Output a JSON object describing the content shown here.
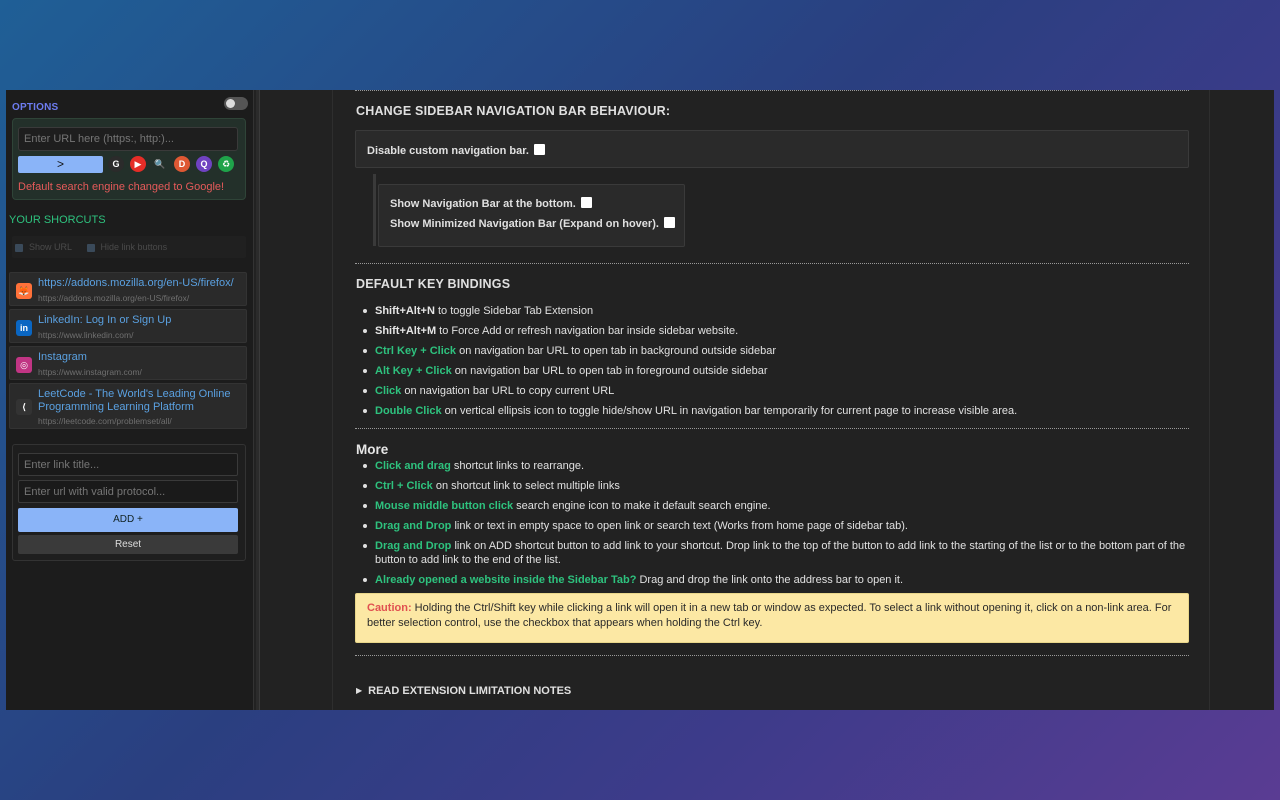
{
  "sidebar": {
    "options_title": "OPTIONS",
    "url_placeholder": "Enter URL here (https:, http:)...",
    "go_label": ">",
    "search_engines": [
      {
        "name": "google-icon",
        "glyph": "G",
        "color": "#ffffff",
        "bg": "#2b2b2b"
      },
      {
        "name": "youtube-icon",
        "glyph": "▶",
        "color": "#ffffff",
        "bg": "#e52d27"
      },
      {
        "name": "search-icon",
        "glyph": "🔍",
        "color": "#4aa3ff",
        "bg": "transparent"
      },
      {
        "name": "duckduckgo-icon",
        "glyph": "D",
        "color": "#ffffff",
        "bg": "#de5833"
      },
      {
        "name": "qwant-icon",
        "glyph": "Q",
        "color": "#ffffff",
        "bg": "#6f42c1"
      },
      {
        "name": "recycle-icon",
        "glyph": "♻",
        "color": "#ffffff",
        "bg": "#1fa34a"
      }
    ],
    "search_message": "Default search engine changed to Google!",
    "shortcuts_title": "YOUR SHORCUTS",
    "show_url_label": "Show URL",
    "hide_buttons_label": "Hide link buttons",
    "links": [
      {
        "title": "https://addons.mozilla.org/en-US/firefox/",
        "url": "https://addons.mozilla.org/en-US/firefox/",
        "icon": "firefox-icon",
        "glyph": "🦊",
        "bg": "#ff7139"
      },
      {
        "title": "LinkedIn: Log In or Sign Up",
        "url": "https://www.linkedin.com/",
        "icon": "linkedin-icon",
        "glyph": "in",
        "bg": "#0a66c2"
      },
      {
        "title": "Instagram",
        "url": "https://www.instagram.com/",
        "icon": "instagram-icon",
        "glyph": "◎",
        "bg": "#c13584"
      },
      {
        "title": "LeetCode - The World's Leading Online Programming Learning Platform",
        "url": "https://leetcode.com/problemset/all/",
        "icon": "leetcode-icon",
        "glyph": "⟨",
        "bg": "#333333"
      }
    ],
    "link_title_placeholder": "Enter link title...",
    "link_url_placeholder": "Enter url with valid protocol...",
    "add_label": "ADD +",
    "reset_label": "Reset"
  },
  "main": {
    "nav_section_title": "CHANGE SIDEBAR NAVIGATION BAR BEHAVIOUR:",
    "disable_nav_label": "Disable custom navigation bar.",
    "show_bottom_label": "Show Navigation Bar at the bottom.",
    "show_minimized_label": "Show Minimized Navigation Bar (Expand on hover).",
    "keys_title": "DEFAULT KEY BINDINGS",
    "key_bindings": [
      {
        "key": "Shift+Alt+N",
        "text": " to toggle Sidebar Tab Extension",
        "style": "k"
      },
      {
        "key": "Shift+Alt+M",
        "text": " to Force Add or refresh navigation bar inside sidebar website.",
        "style": "k"
      },
      {
        "key": "Ctrl Key + Click",
        "text": " on navigation bar URL to open tab in background outside sidebar",
        "style": "g"
      },
      {
        "key": "Alt Key + Click",
        "text": " on navigation bar URL to open tab in foreground outside sidebar",
        "style": "g"
      },
      {
        "key": "Click",
        "text": " on navigation bar URL to copy current URL",
        "style": "g"
      },
      {
        "key": "Double Click",
        "text": " on vertical ellipsis icon to toggle hide/show URL in navigation bar temporarily for current page to increase visible area.",
        "style": "g"
      }
    ],
    "more_title": "More",
    "more_items": [
      {
        "key": "Click and drag",
        "text": " shortcut links to rearrange."
      },
      {
        "key": "Ctrl + Click",
        "text": " on shortcut link to select multiple links"
      },
      {
        "key": "Mouse middle button click",
        "text": " search engine icon to make it default search engine."
      },
      {
        "key": "Drag and Drop",
        "text": " link or text in empty space to open link or search text (Works from home page of sidebar tab)."
      },
      {
        "key": "Drag and Drop",
        "text": " link on ADD shortcut button to add link to your shortcut. Drop link to the top of the button to add link to the starting of the list or to the bottom part of the button to add link to the end of the list."
      },
      {
        "key": "Already opened a website inside the Sidebar Tab?",
        "text": " Drag and drop the link onto the address bar to open it."
      }
    ],
    "caution_label": "Caution:",
    "caution_text": " Holding the Ctrl/Shift key while clicking a link will open it in a new tab or window as expected. To select a link without opening it, click on a non-link area. For better selection control, use the checkbox that appears when holding the Ctrl key.",
    "limitation_label": "READ EXTENSION LIMITATION NOTES"
  },
  "colors": {
    "accent_green": "#2ec27e",
    "accent_blue": "#8ab4f8",
    "options_title": "#6d7cf0",
    "error_red": "#e55a5a",
    "caution_bg": "#fce8a4"
  }
}
